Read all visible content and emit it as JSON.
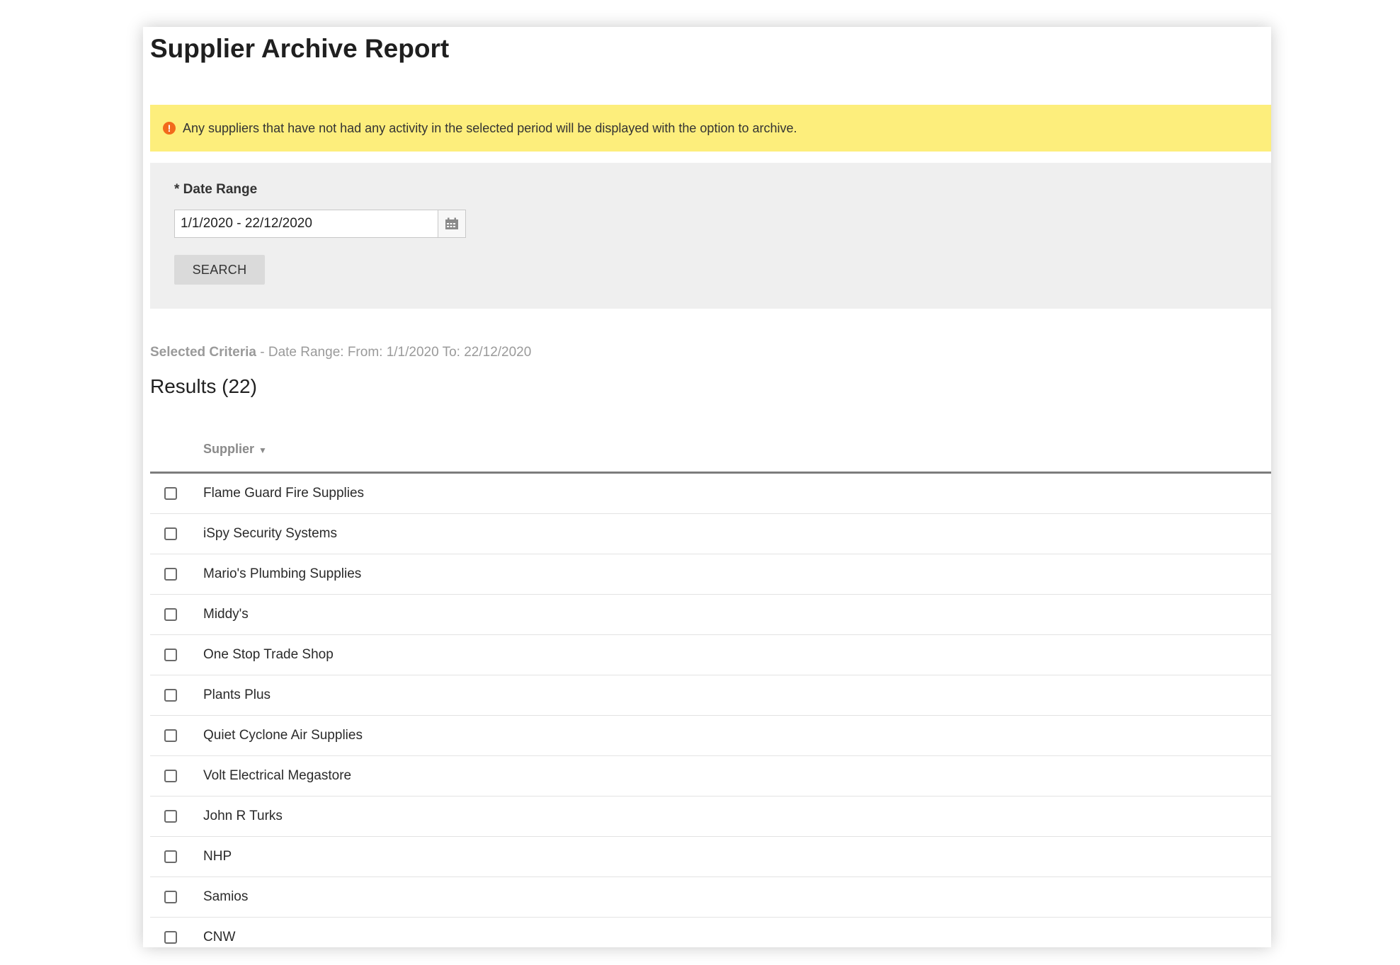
{
  "page": {
    "title": "Supplier Archive Report"
  },
  "alert": {
    "icon": "exclamation-circle-icon",
    "text": "Any suppliers that have not had any activity in the selected period will be displayed with the option to archive."
  },
  "filter": {
    "date_label": "* Date Range",
    "date_value": "1/1/2020 - 22/12/2020",
    "calendar_icon": "calendar-icon",
    "search_label": "SEARCH"
  },
  "criteria": {
    "label": "Selected Criteria",
    "text": " - Date Range: From: 1/1/2020 To: 22/12/2020"
  },
  "results": {
    "heading": "Results (22)",
    "column_supplier": "Supplier",
    "sort_indicator": "▼",
    "rows": [
      "Flame Guard Fire Supplies",
      "iSpy Security Systems",
      "Mario's Plumbing Supplies",
      "Middy's",
      "One Stop Trade Shop",
      "Plants Plus",
      "Quiet Cyclone Air Supplies",
      "Volt Electrical Megastore",
      "John R Turks",
      "NHP",
      "Samios",
      "CNW"
    ]
  },
  "colors": {
    "alert_bg": "#fdee7c",
    "alert_icon": "#f26a1b",
    "filter_bg": "#efefef",
    "button_bg": "#dadada"
  }
}
